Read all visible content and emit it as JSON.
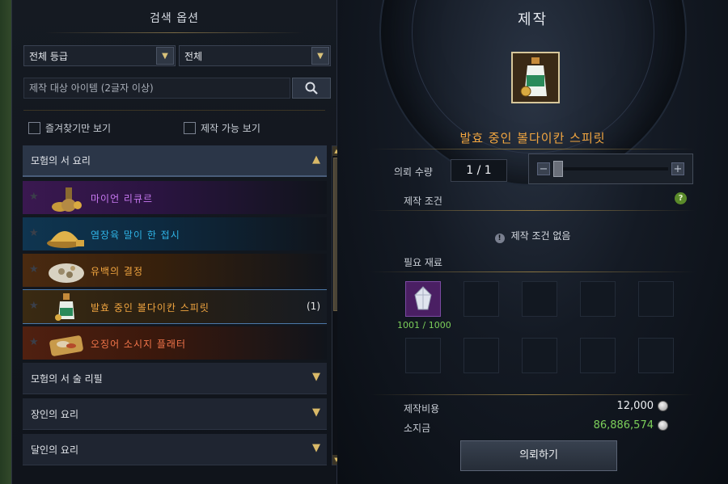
{
  "left_panel": {
    "title": "검색 옵션",
    "grade_dropdown": "전체 등급",
    "type_dropdown": "전체",
    "search_placeholder": "제작 대상 아이템 (2글자 이상)",
    "favorites_only": "즐겨찾기만 보기",
    "craftable_only": "제작 가능 보기",
    "categories": [
      {
        "label": "모험의 서 요리",
        "state": "expanded"
      },
      {
        "label": "모험의 서 술 리필",
        "state": "collapsed"
      },
      {
        "label": "장인의 요리",
        "state": "collapsed"
      },
      {
        "label": "달인의 요리",
        "state": "collapsed"
      }
    ],
    "recipes": [
      {
        "name": "마이언 리큐르",
        "rarity_color": "#c879f2",
        "count": ""
      },
      {
        "name": "염장육 말이 한 접시",
        "rarity_color": "#2fb4e6",
        "count": ""
      },
      {
        "name": "유백의 결정",
        "rarity_color": "#f2a640",
        "count": ""
      },
      {
        "name": "발효 중인 볼다이칸 스피릿",
        "rarity_color": "#f2a640",
        "count": "(1)"
      },
      {
        "name": "오징어 소시지 플래터",
        "rarity_color": "#f2754a",
        "count": ""
      }
    ]
  },
  "right_panel": {
    "title": "제작",
    "item_name": "발효 중인 볼다이칸 스피릿",
    "quantity_label": "의뢰 수량",
    "quantity_value": "1 / 1",
    "conditions_label": "제작 조건",
    "conditions_text": "제작 조건 없음",
    "materials_label": "필요 재료",
    "material_count": "1001 / 1000",
    "cost_label": "제작비용",
    "cost_value": "12,000",
    "owned_label": "소지금",
    "owned_value": "86,886,574",
    "request_button": "의뢰하기",
    "help_icon": "?",
    "info_icon": "!"
  },
  "colors": {
    "gold_accent": "#d9b968",
    "owned_money": "#7ccf5a",
    "epic": "#c879f2",
    "rare": "#2fb4e6",
    "legendary": "#f2a640",
    "relic": "#f2754a"
  }
}
